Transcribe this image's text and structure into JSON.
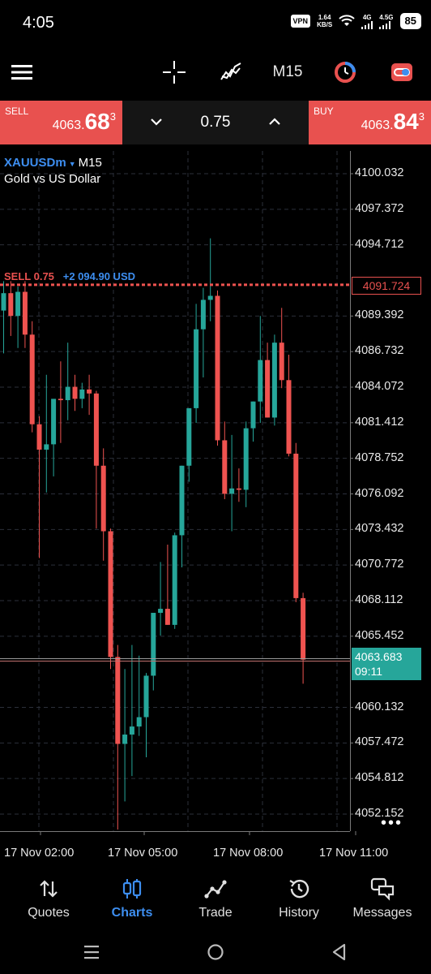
{
  "status_bar": {
    "time": "4:05",
    "vpn": "VPN",
    "speed_value": "1.64",
    "speed_unit": "KB/S",
    "network_1": "4G",
    "network_2": "4.5G",
    "battery": "85"
  },
  "toolbar": {
    "timeframe": "M15"
  },
  "trade_bar": {
    "sell_label": "SELL",
    "sell_price_small": "4063.",
    "sell_price_big": "68",
    "sell_price_sup": "3",
    "lot": "0.75",
    "buy_label": "BUY",
    "buy_price_small": "4063.",
    "buy_price_big": "84",
    "buy_price_sup": "3"
  },
  "chart": {
    "symbol": "XAUUSDm",
    "timeframe": "M15",
    "description": "Gold vs US Dollar",
    "position_line_side": "SELL 0.75",
    "position_line_profit": "+2 094.90 USD",
    "position_price": "4091.724",
    "bid_price": "4063.683",
    "bar_timer": "09:11",
    "more_menu": "•••",
    "price_axis": [
      "4100.032",
      "4097.372",
      "4094.712",
      "4091.724",
      "4089.392",
      "4086.732",
      "4084.072",
      "4081.412",
      "4078.752",
      "4076.092",
      "4073.432",
      "4070.772",
      "4068.112",
      "4065.452",
      "4063.683",
      "4060.132",
      "4057.472",
      "4054.812",
      "4052.152"
    ],
    "time_axis": [
      "17 Nov 02:00",
      "17 Nov 05:00",
      "17 Nov 08:00",
      "17 Nov 11:00"
    ]
  },
  "chart_data": {
    "type": "candlestick",
    "symbol": "XAUUSDm",
    "timeframe": "M15",
    "bull_color": "#26a69a",
    "bear_color": "#ef5350",
    "ylim": [
      4050.5,
      4102
    ],
    "y_ticks": [
      4100.032,
      4097.372,
      4094.712,
      4089.392,
      4086.732,
      4084.072,
      4081.412,
      4078.752,
      4076.092,
      4073.432,
      4070.772,
      4068.112,
      4065.452,
      4060.132,
      4057.472,
      4054.812,
      4052.152
    ],
    "x_ticks": [
      "17 Nov 02:00",
      "17 Nov 05:00",
      "17 Nov 08:00",
      "17 Nov 11:00"
    ],
    "position_price": 4091.724,
    "bid_price": 4063.683,
    "candles": [
      {
        "o": 4089.8,
        "h": 4092.0,
        "l": 4086.6,
        "c": 4091.1
      },
      {
        "o": 4091.1,
        "h": 4092.0,
        "l": 4087.9,
        "c": 4089.4
      },
      {
        "o": 4089.4,
        "h": 4091.6,
        "l": 4087.0,
        "c": 4091.2
      },
      {
        "o": 4091.2,
        "h": 4092.0,
        "l": 4087.0,
        "c": 4088.0
      },
      {
        "o": 4088.0,
        "h": 4089.0,
        "l": 4080.7,
        "c": 4081.3
      },
      {
        "o": 4081.3,
        "h": 4081.9,
        "l": 4071.3,
        "c": 4079.4
      },
      {
        "o": 4079.4,
        "h": 4085.0,
        "l": 4076.2,
        "c": 4079.8
      },
      {
        "o": 4079.8,
        "h": 4083.0,
        "l": 4077.4,
        "c": 4083.2
      },
      {
        "o": 4083.2,
        "h": 4086.0,
        "l": 4079.9,
        "c": 4083.1
      },
      {
        "o": 4083.1,
        "h": 4087.4,
        "l": 4081.6,
        "c": 4084.1
      },
      {
        "o": 4084.1,
        "h": 4085.0,
        "l": 4082.3,
        "c": 4083.2
      },
      {
        "o": 4083.2,
        "h": 4084.4,
        "l": 4082.5,
        "c": 4083.9
      },
      {
        "o": 4083.9,
        "h": 4085.0,
        "l": 4082.0,
        "c": 4083.6
      },
      {
        "o": 4083.6,
        "h": 4083.8,
        "l": 4073.5,
        "c": 4078.2
      },
      {
        "o": 4078.2,
        "h": 4079.5,
        "l": 4071.1,
        "c": 4073.3
      },
      {
        "o": 4073.3,
        "h": 4073.5,
        "l": 4063.0,
        "c": 4063.9
      },
      {
        "o": 4063.9,
        "h": 4064.8,
        "l": 4051.0,
        "c": 4057.4
      },
      {
        "o": 4057.4,
        "h": 4063.0,
        "l": 4053.1,
        "c": 4058.1
      },
      {
        "o": 4058.1,
        "h": 4064.8,
        "l": 4055.0,
        "c": 4058.7
      },
      {
        "o": 4058.7,
        "h": 4064.0,
        "l": 4058.0,
        "c": 4059.4
      },
      {
        "o": 4059.4,
        "h": 4062.7,
        "l": 4056.4,
        "c": 4062.5
      },
      {
        "o": 4062.5,
        "h": 4067.0,
        "l": 4061.4,
        "c": 4067.2
      },
      {
        "o": 4067.2,
        "h": 4071.0,
        "l": 4065.5,
        "c": 4067.5
      },
      {
        "o": 4067.5,
        "h": 4072.3,
        "l": 4066.3,
        "c": 4066.3
      },
      {
        "o": 4066.3,
        "h": 4073.2,
        "l": 4066.0,
        "c": 4073.0
      },
      {
        "o": 4073.0,
        "h": 4078.2,
        "l": 4070.6,
        "c": 4078.2
      },
      {
        "o": 4078.2,
        "h": 4081.9,
        "l": 4077.0,
        "c": 4082.5
      },
      {
        "o": 4082.5,
        "h": 4090.3,
        "l": 4081.4,
        "c": 4088.4
      },
      {
        "o": 4088.4,
        "h": 4091.5,
        "l": 4084.8,
        "c": 4090.6
      },
      {
        "o": 4090.6,
        "h": 4095.2,
        "l": 4089.0,
        "c": 4090.9
      },
      {
        "o": 4090.9,
        "h": 4091.3,
        "l": 4079.7,
        "c": 4080.1
      },
      {
        "o": 4080.1,
        "h": 4081.5,
        "l": 4075.7,
        "c": 4076.1
      },
      {
        "o": 4076.1,
        "h": 4080.5,
        "l": 4073.3,
        "c": 4076.5
      },
      {
        "o": 4076.5,
        "h": 4078.0,
        "l": 4075.5,
        "c": 4076.4
      },
      {
        "o": 4076.4,
        "h": 4081.5,
        "l": 4075.1,
        "c": 4081.0
      },
      {
        "o": 4081.0,
        "h": 4083.0,
        "l": 4080.0,
        "c": 4083.0
      },
      {
        "o": 4083.0,
        "h": 4089.4,
        "l": 4081.4,
        "c": 4086.1
      },
      {
        "o": 4086.1,
        "h": 4087.4,
        "l": 4081.8,
        "c": 4081.8
      },
      {
        "o": 4081.8,
        "h": 4088.0,
        "l": 4081.2,
        "c": 4087.4
      },
      {
        "o": 4087.4,
        "h": 4090.0,
        "l": 4084.0,
        "c": 4084.6
      },
      {
        "o": 4084.6,
        "h": 4086.5,
        "l": 4078.9,
        "c": 4079.1
      },
      {
        "o": 4079.1,
        "h": 4079.9,
        "l": 4068.0,
        "c": 4068.3
      },
      {
        "o": 4068.3,
        "h": 4068.7,
        "l": 4061.9,
        "c": 4063.7
      }
    ]
  },
  "bottom_nav": {
    "items": [
      {
        "label": "Quotes",
        "icon": "swap-vertical-icon"
      },
      {
        "label": "Charts",
        "icon": "candlestick-icon"
      },
      {
        "label": "Trade",
        "icon": "trend-line-icon"
      },
      {
        "label": "History",
        "icon": "history-icon"
      },
      {
        "label": "Messages",
        "icon": "chat-bubbles-icon"
      }
    ],
    "active": "Charts"
  }
}
